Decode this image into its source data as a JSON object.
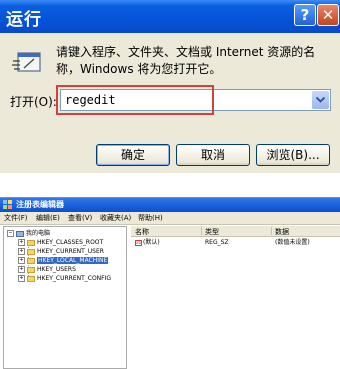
{
  "run_dialog": {
    "title": "运行",
    "help_glyph": "?",
    "close_glyph": "✕",
    "icon": "run-program-icon",
    "description": "请键入程序、文件夹、文档或 Internet 资源的名称，Windows 将为您打开它。",
    "open_label": "打开(O):",
    "open_value": "regedit",
    "buttons": {
      "ok": "确定",
      "cancel": "取消",
      "browse": "浏览(B)..."
    },
    "colors": {
      "titlebar": "#0553d9",
      "highlight": "#d24141",
      "face": "#ece9d8"
    }
  },
  "registry_editor": {
    "title": "注册表编辑器",
    "menu": [
      "文件(F)",
      "编辑(E)",
      "查看(V)",
      "收藏夹(A)",
      "帮助(H)"
    ],
    "tree": {
      "root": "我的电脑",
      "items": [
        "HKEY_CLASSES_ROOT",
        "HKEY_CURRENT_USER",
        "HKEY_LOCAL_MACHINE",
        "HKEY_USERS",
        "HKEY_CURRENT_CONFIG"
      ],
      "selected": "HKEY_LOCAL_MACHINE"
    },
    "columns": [
      "名称",
      "类型",
      "数据"
    ],
    "rows": [
      {
        "name": "(默认)",
        "type": "REG_SZ",
        "data": "(数值未设置)"
      }
    ]
  }
}
